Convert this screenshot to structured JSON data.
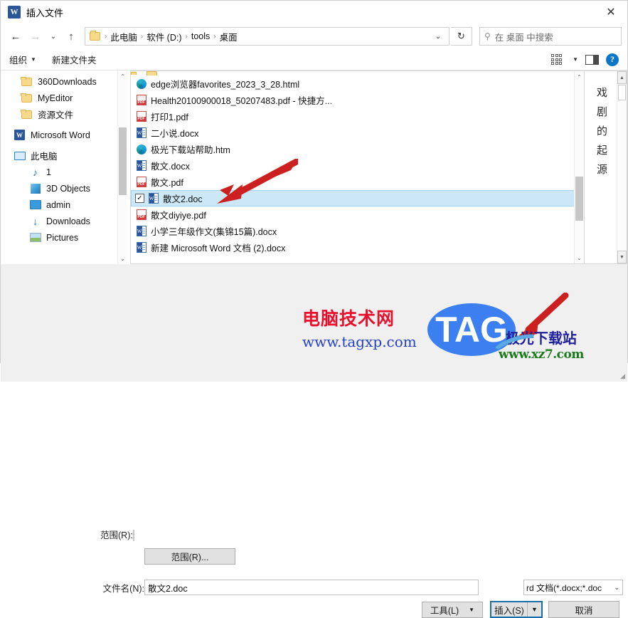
{
  "window": {
    "title": "插入文件",
    "app_icon": "word-icon",
    "close_label": "✕"
  },
  "nav": {
    "back": "←",
    "forward": "→",
    "recent": "⌄",
    "up": "↑",
    "refresh": "↻",
    "breadcrumbs": [
      "此电脑",
      "软件 (D:)",
      "tools",
      "桌面"
    ],
    "separator": "›",
    "dropdown_caret": "⌄"
  },
  "search": {
    "icon": "search-icon",
    "placeholder": "在 桌面 中搜索"
  },
  "toolbar": {
    "organize_label": "组织",
    "organize_caret": "▼",
    "new_folder_label": "新建文件夹",
    "view_caret": "▼",
    "help_label": "?"
  },
  "sidebar": {
    "items": [
      {
        "label": "360Downloads",
        "icon": "folder-icon",
        "indent": 1
      },
      {
        "label": "MyEditor",
        "icon": "folder-icon",
        "indent": 1
      },
      {
        "label": "资源文件",
        "icon": "folder-icon",
        "indent": 1
      },
      {
        "label": "Microsoft Word",
        "icon": "word-icon",
        "indent": 0
      },
      {
        "label": "此电脑",
        "icon": "computer-icon",
        "indent": 0
      },
      {
        "label": "1",
        "icon": "music-icon",
        "indent": 1
      },
      {
        "label": "3D Objects",
        "icon": "cube-icon",
        "indent": 1
      },
      {
        "label": "admin",
        "icon": "desktop-icon",
        "indent": 1
      },
      {
        "label": "Downloads",
        "icon": "download-icon",
        "indent": 1
      },
      {
        "label": "Pictures",
        "icon": "picture-icon",
        "indent": 1
      }
    ],
    "scroll_up": "⌃",
    "scroll_down": "⌄"
  },
  "files": {
    "rows": [
      {
        "name": "edge浏览器favorites_2023_3_28.html",
        "icon": "edge-icon",
        "selected": false
      },
      {
        "name": "Health20100900018_50207483.pdf - 快捷方...",
        "icon": "pdf-shortcut-icon",
        "selected": false
      },
      {
        "name": "打印1.pdf",
        "icon": "pdf-icon",
        "selected": false
      },
      {
        "name": "二小说.docx",
        "icon": "word-doc-icon",
        "selected": false
      },
      {
        "name": "极光下载站帮助.htm",
        "icon": "edge-icon",
        "selected": false
      },
      {
        "name": "散文.docx",
        "icon": "word-doc-icon",
        "selected": false
      },
      {
        "name": "散文.pdf",
        "icon": "pdf-icon",
        "selected": false
      },
      {
        "name": "散文2.doc",
        "icon": "word-doc-icon",
        "selected": true,
        "checked": "✓"
      },
      {
        "name": "散文diyiye.pdf",
        "icon": "pdf-icon",
        "selected": false
      },
      {
        "name": "小学三年级作文(集锦15篇).docx",
        "icon": "word-doc-icon",
        "selected": false
      },
      {
        "name": "新建 Microsoft Word 文档 (2).docx",
        "icon": "word-doc-icon",
        "selected": false
      }
    ],
    "scroll_up": "⌃",
    "scroll_down": "⌄"
  },
  "preview": {
    "text": "戏剧的起源",
    "scroll_up": "▲",
    "scroll_down": "▼"
  },
  "form": {
    "range_label": "范围(R):",
    "range_value": "",
    "range_button": "范围(R)...",
    "filename_label": "文件名(N):",
    "filename_value": "散文2.doc",
    "filetype_value": "rd 文档(*.docx;*.doc",
    "filetype_caret": "⌄",
    "tools_label": "工具(L)",
    "tools_caret": "▼",
    "insert_label": "插入(S)",
    "insert_caret": "▼",
    "cancel_label": "取消"
  },
  "watermarks": {
    "brand_cn": "电脑技术网",
    "brand_url": "www.tagxp.com",
    "tag_logo": "TAG",
    "site_cn": "极光下载站",
    "site_url": "www.xz7.com"
  },
  "colors": {
    "accent": "#2b579a",
    "selection": "#cce8f6",
    "arrow_red": "#cc1f1f",
    "watermark_red": "#e8112d",
    "tag_blue": "#3b7ff0"
  }
}
